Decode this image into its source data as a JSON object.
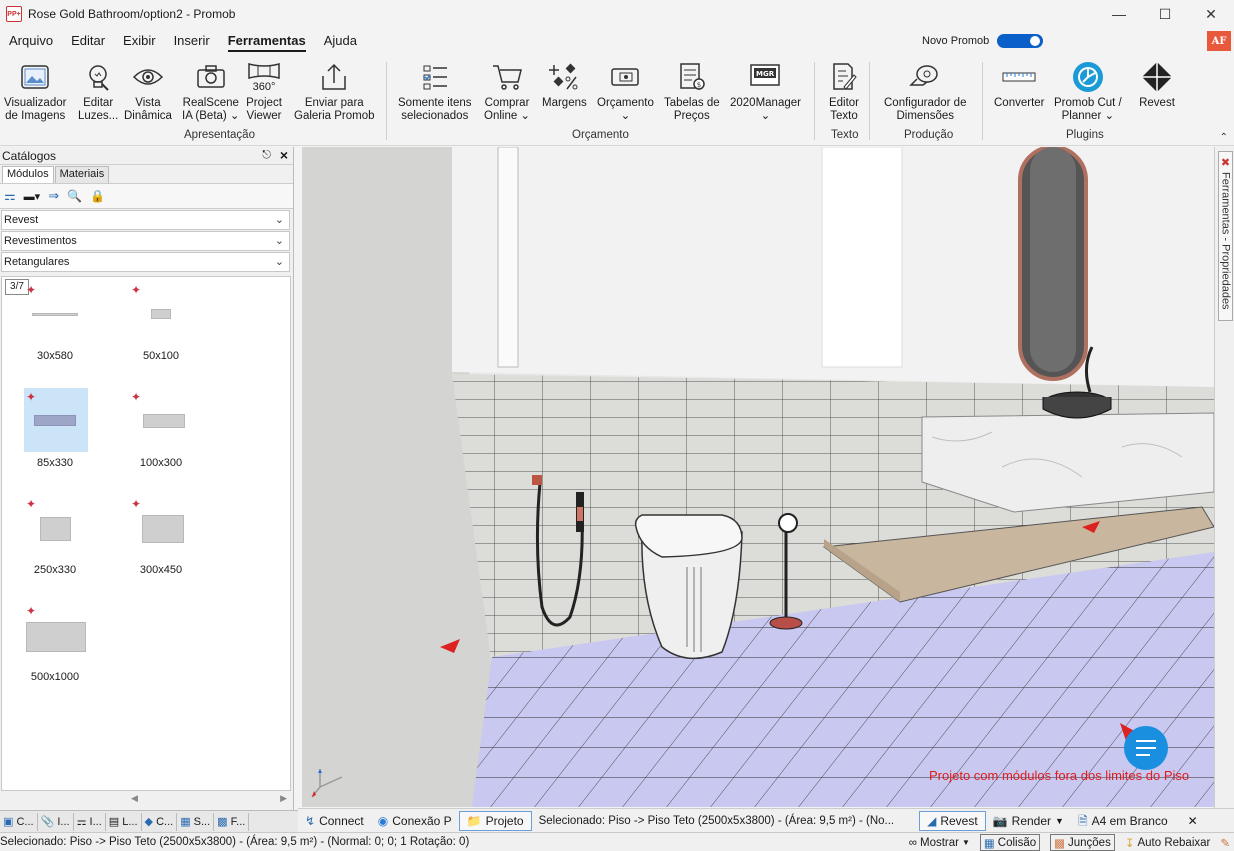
{
  "window": {
    "title": "Rose Gold Bathroom/option2 - Promob",
    "app_icon": "PP+"
  },
  "menu": [
    "Arquivo",
    "Editar",
    "Exibir",
    "Inserir",
    "Ferramentas",
    "Ajuda"
  ],
  "active_menu": "Ferramentas",
  "novo_promob": {
    "label": "Novo Promob",
    "on": true
  },
  "user_badge": "AF",
  "ribbon": {
    "buttons": [
      {
        "label": "Visualizador de Imagens",
        "l1": "Visualizador",
        "l2": "de Imagens",
        "icon": "image-viewer-icon"
      },
      {
        "label": "Editar Luzes...",
        "l1": "Editar",
        "l2": "Luzes...",
        "icon": "lightbulb-icon"
      },
      {
        "label": "Vista Dinâmica",
        "l1": "Vista",
        "l2": "Dinâmica",
        "icon": "eye-icon"
      },
      {
        "label": "RealScene IA (Beta)",
        "l1": "RealScene",
        "l2": "IA (Beta) ⌄",
        "icon": "camera-icon"
      },
      {
        "label": "360° Project Viewer",
        "l1": "Project",
        "l2": "Viewer",
        "icon": "360-viewer-icon",
        "badge": "360°"
      },
      {
        "label": "Enviar para Galeria Promob",
        "l1": "Enviar para",
        "l2": "Galeria Promob",
        "icon": "upload-icon"
      },
      {
        "label": "Somente itens selecionados",
        "l1": "Somente itens",
        "l2": "selecionados",
        "icon": "checklist-icon"
      },
      {
        "label": "Comprar Online",
        "l1": "Comprar",
        "l2": "Online ⌄",
        "icon": "cart-icon"
      },
      {
        "label": "Margens",
        "l1": "Margens",
        "l2": "",
        "icon": "margins-icon"
      },
      {
        "label": "Orçamento",
        "l1": "Orçamento",
        "l2": "⌄",
        "icon": "budget-icon"
      },
      {
        "label": "Tabelas de Preços",
        "l1": "Tabelas de",
        "l2": "Preços",
        "icon": "price-table-icon"
      },
      {
        "label": "2020Manager",
        "l1": "2020Manager",
        "l2": "⌄",
        "icon": "manager-icon",
        "badge": "MGR"
      },
      {
        "label": "Editor Texto",
        "l1": "Editor",
        "l2": "Texto",
        "icon": "text-editor-icon"
      },
      {
        "label": "Configurador de Dimensões",
        "l1": "Configurador de",
        "l2": "Dimensões",
        "icon": "tape-measure-icon"
      },
      {
        "label": "Converter",
        "l1": "Converter",
        "l2": "",
        "icon": "ruler-icon"
      },
      {
        "label": "Promob Cut / Planner",
        "l1": "Promob Cut /",
        "l2": "Planner ⌄",
        "icon": "saw-blade-icon"
      },
      {
        "label": "Revest",
        "l1": "Revest",
        "l2": "",
        "icon": "revest-icon"
      }
    ],
    "groups": [
      "Apresentação",
      "Orçamento",
      "Texto",
      "Produção",
      "Plugins"
    ]
  },
  "catalog": {
    "title": "Catálogos",
    "tabs": [
      "Módulos",
      "Materiais"
    ],
    "selects": [
      "Revest",
      "Revestimentos",
      "Retangulares"
    ],
    "page_indicator": "3/7",
    "items": [
      {
        "label": "30x580"
      },
      {
        "label": "50x100"
      },
      {
        "label": "85x330",
        "selected": true
      },
      {
        "label": "100x300"
      },
      {
        "label": "250x330"
      },
      {
        "label": "300x450"
      },
      {
        "label": "500x1000"
      }
    ],
    "bottom_tabs": [
      "C...",
      "I...",
      "I...",
      "L...",
      "C...",
      "S...",
      "F..."
    ]
  },
  "right_dock": {
    "tab": "Ferramentas - Propriedades"
  },
  "viewport": {
    "warning": "Projeto com módulos fora dos limites do Piso"
  },
  "viewport_bar": {
    "items": [
      "Connect",
      "Conexão P",
      "Projeto"
    ],
    "selection": "Selecionado: Piso -> Piso Teto (2500x5x3800) - (Área: 9,5 m²) - (No...",
    "revest": "Revest",
    "render": "Render",
    "paper": "A4 em Branco"
  },
  "statusbar": {
    "text": "Selecionado: Piso -> Piso Teto (2500x5x3800) - (Área: 9,5 m²) - (Normal: 0; 0; 1 Rotação: 0)",
    "mostrar": "Mostrar",
    "colisao": "Colisão",
    "juncoes": "Junções",
    "auto_rebaixar": "Auto Rebaixar"
  }
}
